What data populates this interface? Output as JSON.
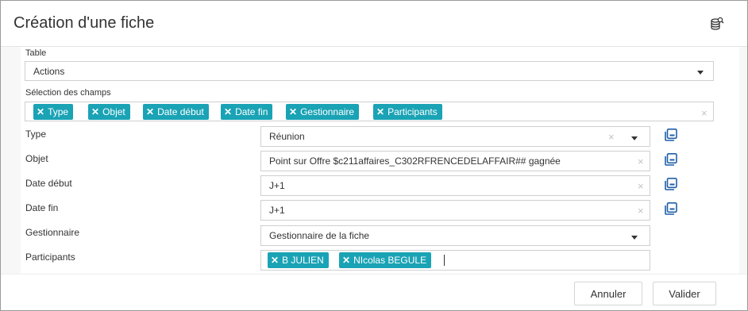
{
  "dialog": {
    "title": "Création d'une fiche",
    "header_icon": "database-search-icon"
  },
  "table": {
    "label": "Table",
    "value": "Actions"
  },
  "fields_selection": {
    "label": "Sélection des champs",
    "tags": [
      "Type",
      "Objet",
      "Date début",
      "Date fin",
      "Gestionnaire",
      "Participants"
    ]
  },
  "fields": {
    "type": {
      "label": "Type",
      "value": "Réunion"
    },
    "objet": {
      "label": "Objet",
      "value": "Point sur Offre $c211affaires_C302RFRENCEDELAFFAIR## gagnée"
    },
    "date_debut": {
      "label": "Date début",
      "value": "J+1"
    },
    "date_fin": {
      "label": "Date fin",
      "value": "J+1"
    },
    "gestionnaire": {
      "label": "Gestionnaire",
      "value": "Gestionnaire de la fiche"
    },
    "participants": {
      "label": "Participants",
      "tags": [
        "B JULIEN",
        "NIcolas BEGULE"
      ]
    }
  },
  "footer": {
    "cancel_label": "Annuler",
    "submit_label": "Valider"
  },
  "colors": {
    "tag": "#1aa3b5",
    "icon_accent": "#1f5fa8"
  }
}
